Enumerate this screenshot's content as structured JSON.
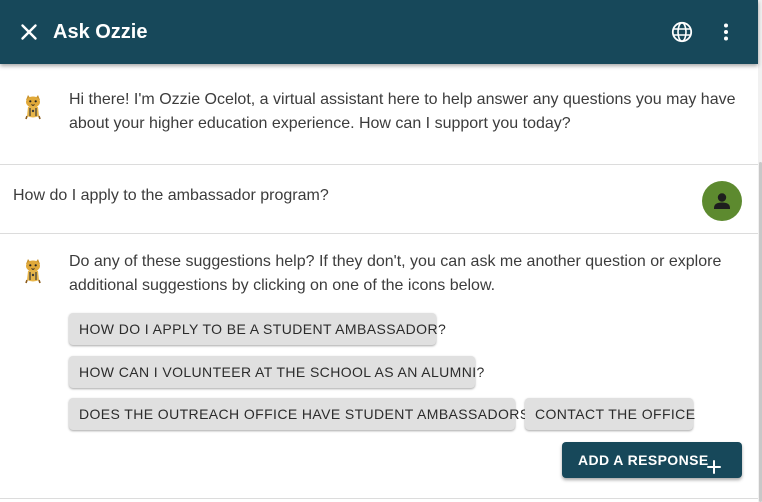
{
  "header": {
    "title": "Ask Ozzie",
    "icons": {
      "close": "close-icon",
      "language": "globe-icon",
      "menu": "more-vertical-icon"
    }
  },
  "colors": {
    "header_bg": "#17485a",
    "user_avatar_bg": "#5d8a2f",
    "chip_bg": "#e0e0e0",
    "primary_button_bg": "#17485a"
  },
  "messages": [
    {
      "sender": "bot",
      "avatar": "ocelot-mascot-icon",
      "text": "Hi there! I'm Ozzie Ocelot, a virtual assistant here to help answer any questions you may have about your higher education experience. How can I support you today?"
    },
    {
      "sender": "user",
      "avatar": "person-icon",
      "text": "How do I apply to the ambassador program?"
    },
    {
      "sender": "bot",
      "avatar": "ocelot-mascot-icon",
      "text": "Do any of these suggestions help? If they don't, you can ask me another question or explore additional suggestions by clicking on one of the icons below."
    }
  ],
  "suggestions": [
    "HOW DO I APPLY TO BE A STUDENT AMBASSADOR?",
    "HOW CAN I VOLUNTEER AT THE SCHOOL AS AN ALUMNI?",
    "DOES THE OUTREACH OFFICE HAVE STUDENT AMBASSADORS?",
    "CONTACT THE OFFICE"
  ],
  "add_response": {
    "label": "ADD A RESPONSE",
    "icon": "plus-icon"
  }
}
